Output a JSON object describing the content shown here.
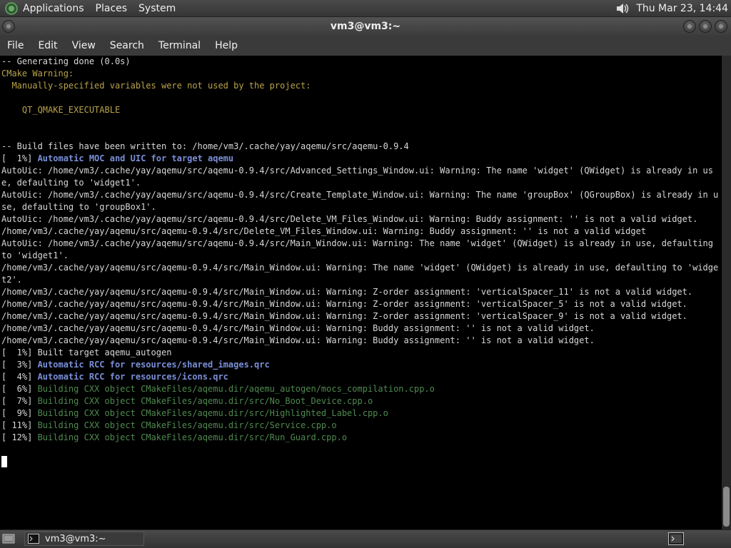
{
  "top_panel": {
    "menus": [
      "Applications",
      "Places",
      "System"
    ],
    "clock": "Thu Mar 23, 14:44"
  },
  "window": {
    "title": "vm3@vm3:~"
  },
  "menu_bar": {
    "items": [
      "File",
      "Edit",
      "View",
      "Search",
      "Terminal",
      "Help"
    ]
  },
  "terminal": {
    "lines": [
      {
        "text": "-- Generating done (0.0s)",
        "color": "#d8d8d8"
      },
      {
        "text": "CMake Warning:",
        "color": "#b8a24a"
      },
      {
        "text": "  Manually-specified variables were not used by the project:",
        "color": "#b8a24a"
      },
      {
        "text": "",
        "color": "#d8d8d8"
      },
      {
        "text": "    QT_QMAKE_EXECUTABLE",
        "color": "#b8a24a"
      },
      {
        "text": "",
        "color": "#d8d8d8"
      },
      {
        "text": "",
        "color": "#d8d8d8"
      },
      {
        "text": "-- Build files have been written to: /home/vm3/.cache/yay/aqemu/src/aqemu-0.9.4",
        "color": "#d8d8d8"
      },
      {
        "text": "[  1%] Automatic MOC and UIC for target aqemu",
        "color": "#7a8fd8",
        "prefix": "[  1%] "
      },
      {
        "text": "AutoUic: /home/vm3/.cache/yay/aqemu/src/aqemu-0.9.4/src/Advanced_Settings_Window.ui: Warning: The name 'widget' (QWidget) is already in use, defaulting to 'widget1'.",
        "color": "#d8d8d8"
      },
      {
        "text": "AutoUic: /home/vm3/.cache/yay/aqemu/src/aqemu-0.9.4/src/Create_Template_Window.ui: Warning: The name 'groupBox' (QGroupBox) is already in use, defaulting to 'groupBox1'.",
        "color": "#d8d8d8"
      },
      {
        "text": "AutoUic: /home/vm3/.cache/yay/aqemu/src/aqemu-0.9.4/src/Delete_VM_Files_Window.ui: Warning: Buddy assignment: '' is not a valid widget.",
        "color": "#d8d8d8"
      },
      {
        "text": "/home/vm3/.cache/yay/aqemu/src/aqemu-0.9.4/src/Delete_VM_Files_Window.ui: Warning: Buddy assignment: '' is not a valid widget",
        "color": "#d8d8d8"
      },
      {
        "text": "AutoUic: /home/vm3/.cache/yay/aqemu/src/aqemu-0.9.4/src/Main_Window.ui: Warning: The name 'widget' (QWidget) is already in use, defaulting to 'widget1'.",
        "color": "#d8d8d8"
      },
      {
        "text": "/home/vm3/.cache/yay/aqemu/src/aqemu-0.9.4/src/Main_Window.ui: Warning: The name 'widget' (QWidget) is already in use, defaulting to 'widget2'.",
        "color": "#d8d8d8"
      },
      {
        "text": "/home/vm3/.cache/yay/aqemu/src/aqemu-0.9.4/src/Main_Window.ui: Warning: Z-order assignment: 'verticalSpacer_11' is not a valid widget.",
        "color": "#d8d8d8"
      },
      {
        "text": "/home/vm3/.cache/yay/aqemu/src/aqemu-0.9.4/src/Main_Window.ui: Warning: Z-order assignment: 'verticalSpacer_5' is not a valid widget.",
        "color": "#d8d8d8"
      },
      {
        "text": "/home/vm3/.cache/yay/aqemu/src/aqemu-0.9.4/src/Main_Window.ui: Warning: Z-order assignment: 'verticalSpacer_9' is not a valid widget.",
        "color": "#d8d8d8"
      },
      {
        "text": "/home/vm3/.cache/yay/aqemu/src/aqemu-0.9.4/src/Main_Window.ui: Warning: Buddy assignment: '' is not a valid widget.",
        "color": "#d8d8d8"
      },
      {
        "text": "/home/vm3/.cache/yay/aqemu/src/aqemu-0.9.4/src/Main_Window.ui: Warning: Buddy assignment: '' is not a valid widget.",
        "color": "#d8d8d8"
      },
      {
        "text": "[  1%] Built target aqemu_autogen",
        "color": "#d8d8d8"
      },
      {
        "text": "[  3%] Automatic RCC for resources/shared_images.qrc",
        "color": "#7a8fd8",
        "prefix": "[  3%] "
      },
      {
        "text": "[  4%] Automatic RCC for resources/icons.qrc",
        "color": "#7a8fd8",
        "prefix": "[  4%] "
      },
      {
        "text": "[  6%] Building CXX object CMakeFiles/aqemu.dir/aqemu_autogen/mocs_compilation.cpp.o",
        "color": "#4f8a4f",
        "prefix": "[  6%] "
      },
      {
        "text": "[  7%] Building CXX object CMakeFiles/aqemu.dir/src/No_Boot_Device.cpp.o",
        "color": "#4f8a4f",
        "prefix": "[  7%] "
      },
      {
        "text": "[  9%] Building CXX object CMakeFiles/aqemu.dir/src/Highlighted_Label.cpp.o",
        "color": "#4f8a4f",
        "prefix": "[  9%] "
      },
      {
        "text": "[ 11%] Building CXX object CMakeFiles/aqemu.dir/src/Service.cpp.o",
        "color": "#4f8a4f",
        "prefix": "[ 11%] "
      },
      {
        "text": "[ 12%] Building CXX object CMakeFiles/aqemu.dir/src/Run_Guard.cpp.o",
        "color": "#4f8a4f",
        "prefix": "[ 12%] "
      }
    ]
  },
  "taskbar": {
    "task_label": "vm3@vm3:~"
  },
  "colors": {
    "terminal_bg": "#000000",
    "default_fg": "#d8d8d8",
    "warning_yellow": "#b8a24a",
    "bold_blue": "#7a8fd8",
    "build_green": "#4f8a4f"
  },
  "icons": {
    "top_panel_menu": "gnome-foot-icon",
    "volume": "volume-icon",
    "taskbar": "terminal-icon",
    "show_desktop": "show-desktop-icon"
  }
}
